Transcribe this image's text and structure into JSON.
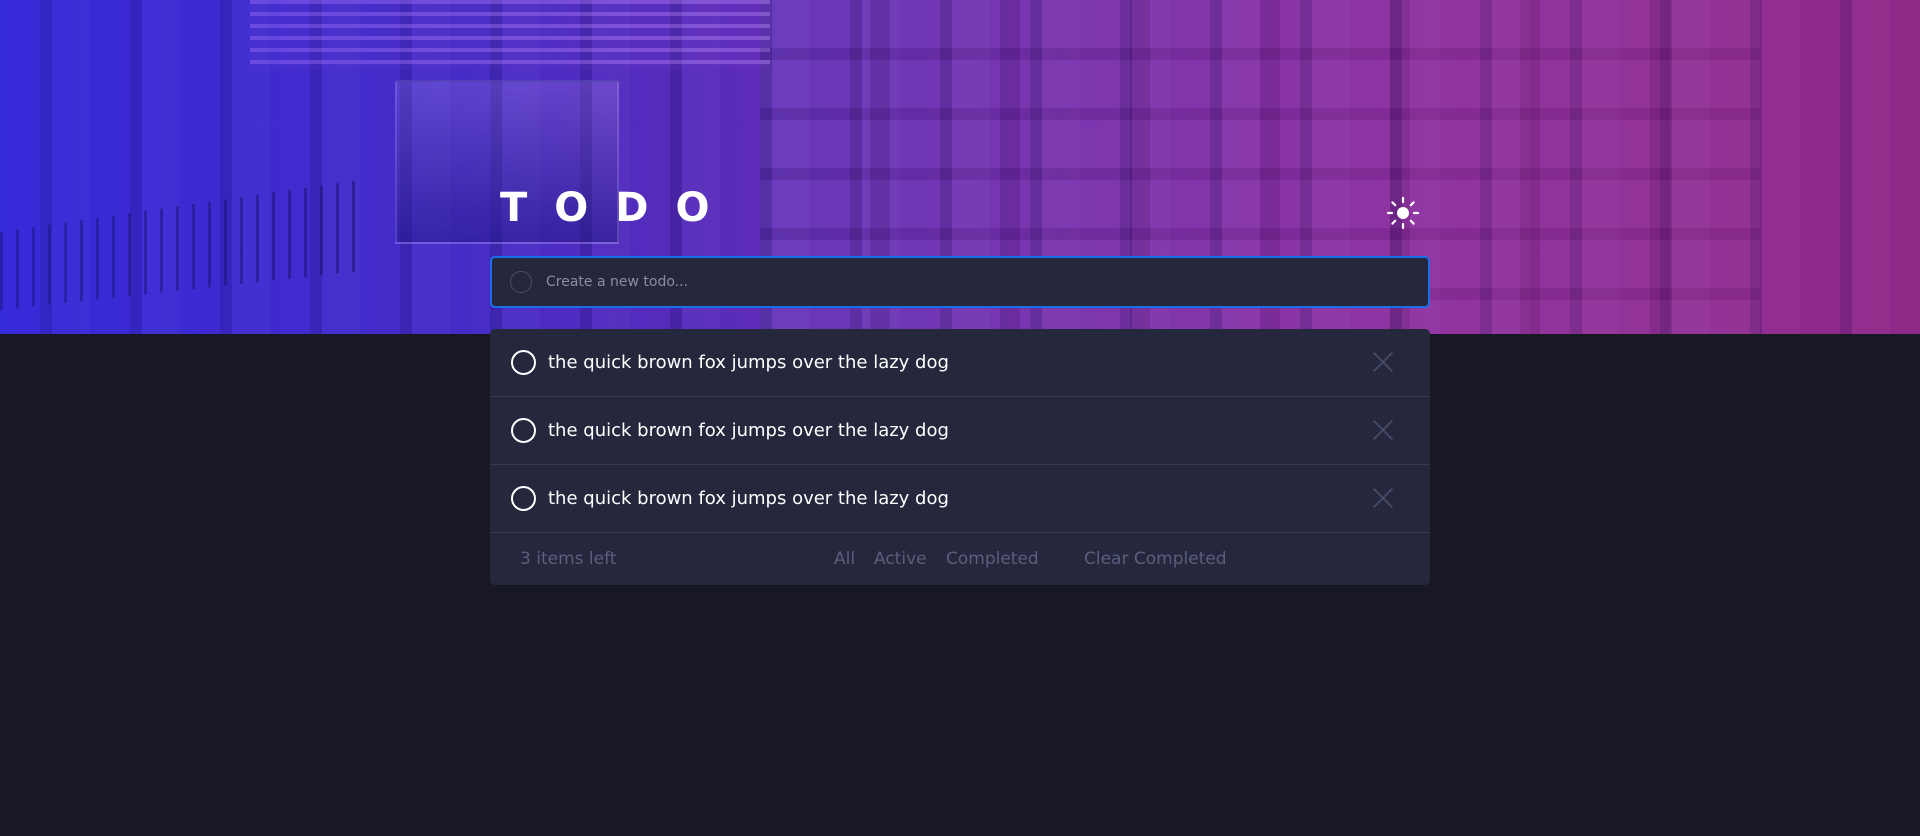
{
  "header": {
    "title": "TODO",
    "theme_icon": "sun-icon"
  },
  "new_todo": {
    "placeholder": "Create a new todo..."
  },
  "todos": [
    {
      "text": "the quick brown fox jumps over the lazy dog",
      "completed": false
    },
    {
      "text": "the quick brown fox jumps over the lazy dog",
      "completed": false
    },
    {
      "text": "the quick brown fox jumps over the lazy dog",
      "completed": false
    }
  ],
  "footer": {
    "items_left": "3 items left",
    "filters": [
      "All",
      "Active",
      "Completed"
    ],
    "clear": "Clear Completed"
  },
  "colors": {
    "background": "#181824",
    "panel": "#25273c",
    "input_border": "#1a6fe6",
    "muted_text": "#5b5e7e"
  }
}
